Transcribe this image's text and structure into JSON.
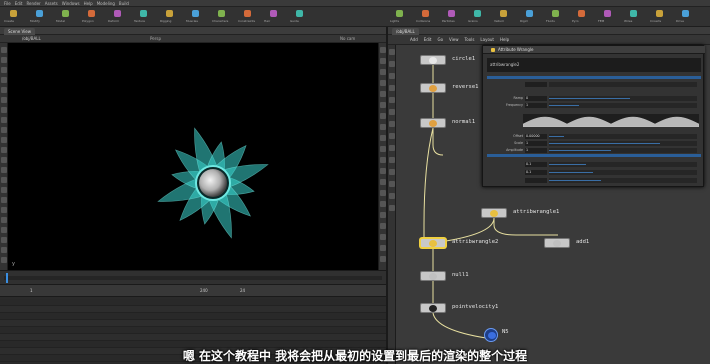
{
  "menubar": {
    "items": [
      "File",
      "Edit",
      "Render",
      "Assets",
      "Windows",
      "Help",
      "Modeling",
      "Build"
    ]
  },
  "shelf": {
    "left_tools": [
      "Create",
      "Modify",
      "Model",
      "Polygon",
      "Deform",
      "Texture",
      "Rigging",
      "Muscles",
      "Characters",
      "Constraints",
      "Hair",
      "Guide"
    ],
    "right_tools": [
      "Lights",
      "Collisions",
      "Particles",
      "Grains",
      "Vellum",
      "Rigid",
      "Fluids",
      "Pyro",
      "FEM",
      "Wires",
      "Crowds",
      "Drive"
    ],
    "accent_colors": [
      "#c9a23a",
      "#4aa0d8",
      "#7fb24e",
      "#d46a3a",
      "#b05ab8",
      "#3fb7a8"
    ]
  },
  "left_panel": {
    "tab": "Scene View",
    "path": "/obj/BALL",
    "viewport": {
      "view": "Persp",
      "camera": "No cam",
      "axis_label": "y"
    }
  },
  "timeline": {
    "frame": "1",
    "end": "240",
    "fps": "24"
  },
  "right_panel": {
    "tab": "/obj/BALL",
    "menu": [
      "Add",
      "Edit",
      "Go",
      "View",
      "Tools",
      "Layout",
      "Help"
    ],
    "params": {
      "node_type": "Attribute Wrangle",
      "node_name": "attribwrangle2",
      "rows": [
        {
          "label": "",
          "value": "",
          "fill": 0.0
        },
        {
          "label": "Ramp",
          "value": "0",
          "fill": 0.55
        },
        {
          "label": "Frequency",
          "value": "1",
          "fill": 0.2
        },
        {
          "label": "Offset",
          "value": "0.00000",
          "fill": 0.1
        },
        {
          "label": "Scale",
          "value": "1",
          "fill": 0.75
        },
        {
          "label": "Amplitude",
          "value": "1",
          "fill": 0.42
        },
        {
          "label": "",
          "value": "0.1",
          "fill": 0.25
        },
        {
          "label": "",
          "value": "0.1",
          "fill": 0.3
        },
        {
          "label": "",
          "value": "",
          "fill": 0.35
        }
      ]
    },
    "nodes": [
      {
        "name": "circle1",
        "icon": "circle-icon",
        "color": "#e8e8e8"
      },
      {
        "name": "reverse1",
        "icon": "reverse-icon",
        "color": "#e0a040"
      },
      {
        "name": "normal1",
        "icon": "normal-icon",
        "color": "#e0a040"
      },
      {
        "name": "attribwrangle1",
        "icon": "wrangle-icon",
        "color": "#e8c040"
      },
      {
        "name": "add1",
        "icon": "add-icon",
        "color": "#c0c0c0"
      },
      {
        "name": "attribwrangle2",
        "icon": "wrangle-icon",
        "color": "#e8c040"
      },
      {
        "name": "null1",
        "icon": "null-icon",
        "color": "#c0c0c0"
      },
      {
        "name": "pointvelocity1",
        "icon": "velocity-icon",
        "color": "#222222"
      },
      {
        "name": "N5",
        "icon": "output-icon",
        "color": "#3a6ee0"
      }
    ]
  },
  "subtitle": "嗯 在这个教程中 我将会把从最初的设置到最后的渲染的整个过程"
}
